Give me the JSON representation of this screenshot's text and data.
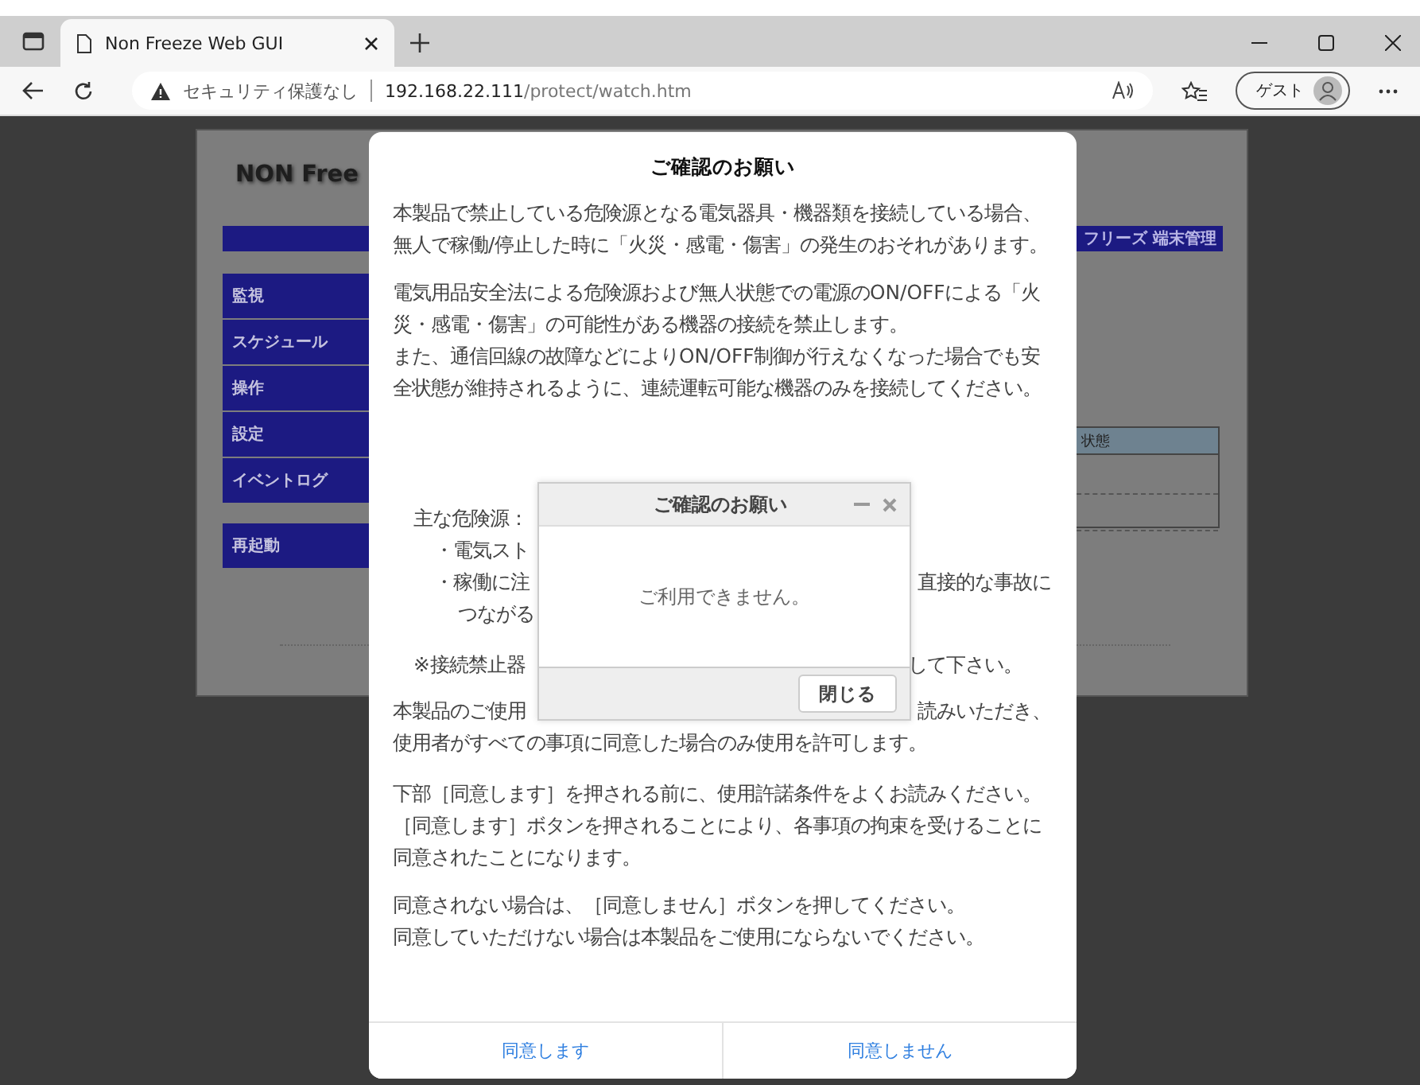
{
  "browser": {
    "tab_title": "Non Freeze Web GUI",
    "security": "セキュリティ保護なし",
    "url_host": "192.168.22.111",
    "url_path": "/protect/watch.htm",
    "profile": "ゲスト"
  },
  "background_page": {
    "logo": "NON Free",
    "banner": "フリーズ 端末管理",
    "nav": [
      "監視",
      "スケジュール",
      "操作",
      "設定",
      "イベントログ"
    ],
    "restart": "再起動",
    "table_header": "状態"
  },
  "modal": {
    "title": "ご確認のお願い",
    "blocks": [
      {
        "kind": "paragraph",
        "lines": [
          "本製品で禁止している危険源となる電気器具・機器類を接続している場合、無人で稼働/停止した時に「火災・感電・傷害」の発生のおそれがあります。"
        ]
      },
      {
        "kind": "paragraph",
        "lines": [
          "電気用品安全法による危険源および無人状態での電源のON/OFFによる「火災・感電・傷害」の可能性がある機器の接続を禁止します。",
          "また、通信回線の故障などによりON/OFF制御が行えなくなった場合でも安全状態が維持されるように、連続運転可能な機器のみを接続してください。"
        ]
      },
      {
        "kind": "covered",
        "rows": [
          {
            "kind": "label",
            "left": "主な危険源："
          },
          {
            "kind": "item",
            "left": "・電気スト"
          },
          {
            "kind": "item",
            "left": "・稼働に注",
            "right": "直接的な事故に"
          },
          {
            "kind": "continuation",
            "left": "つながる"
          },
          {
            "kind": "note",
            "left": "※接続禁止器",
            "right": "して下さい。"
          },
          {
            "kind": "text",
            "left": "本製品のご使用",
            "right": "読みいただき、"
          },
          {
            "kind": "line",
            "left": "使用者がすべての事項に同意した場合のみ使用を許可します。"
          }
        ]
      },
      {
        "kind": "paragraph",
        "lines": [
          "下部［同意します］を押される前に、使用許諾条件をよくお読みください。",
          "［同意します］ボタンを押されることにより、各事項の拘束を受けることに同意されたことになります。"
        ]
      },
      {
        "kind": "paragraph",
        "lines": [
          "同意されない場合は、［同意しません］ボタンを押してください。",
          "同意していただけない場合は本製品をご使用にならないでください。"
        ]
      }
    ],
    "buttons": [
      "同意します",
      "同意しません"
    ]
  },
  "alert": {
    "title": "ご確認のお願い",
    "message": "ご利用できません。",
    "button": "閉じる"
  }
}
